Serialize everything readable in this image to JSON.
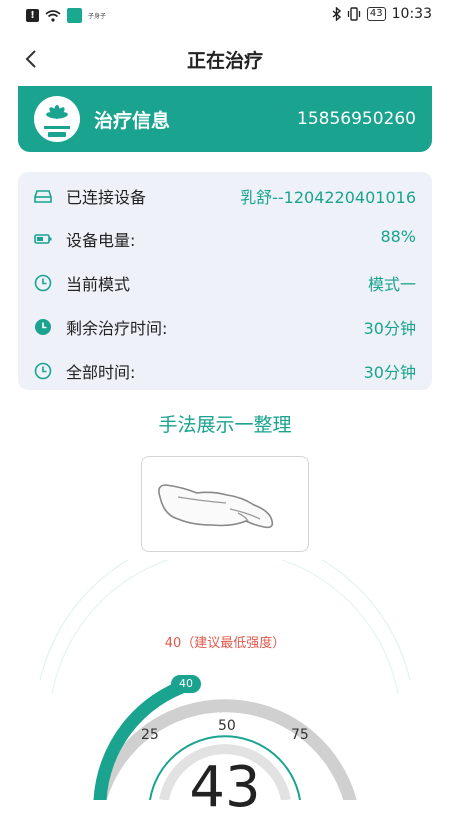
{
  "status_bar": {
    "time": "10:33",
    "battery": "43",
    "tiny_text": "子身子"
  },
  "header": {
    "title": "正在治疗"
  },
  "banner": {
    "title": "治疗信息",
    "phone": "15856950260",
    "logo_icon": "lotus-logo-icon"
  },
  "info": {
    "rows": [
      {
        "icon": "device-icon",
        "label": "已连接设备",
        "value": "乳舒--1204220401016"
      },
      {
        "icon": "battery-icon",
        "label": "设备电量:",
        "value": "88%"
      },
      {
        "icon": "clock-icon",
        "label": "当前模式",
        "value": "模式一"
      },
      {
        "icon": "clock-filled-icon",
        "label": "剩余治疗时间:",
        "value": "30分钟"
      },
      {
        "icon": "clock-icon",
        "label": "全部时间:",
        "value": "30分钟"
      }
    ]
  },
  "technique": {
    "title": "手法展示一整理",
    "image_icon": "hand-icon"
  },
  "gauge": {
    "min_hint": "40（建议最低强度）",
    "marker": "40",
    "ticks": [
      "25",
      "50",
      "75"
    ],
    "value": "43",
    "colors": {
      "accent": "#1aa38f",
      "track": "#d0d0d0",
      "hint": "#e0584b"
    }
  }
}
